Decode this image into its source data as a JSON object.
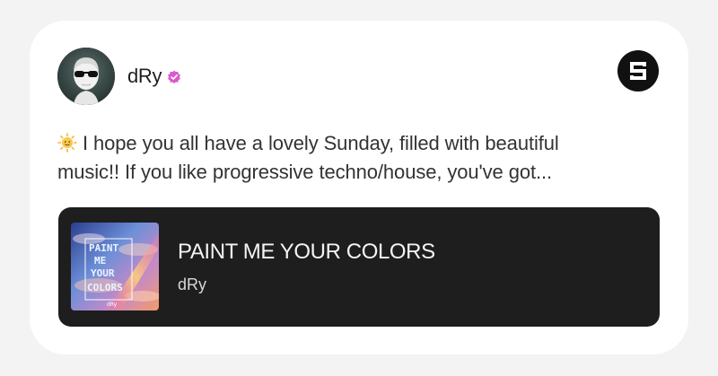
{
  "post": {
    "author": "dRy",
    "text_line1": "I hope you all have a lovely Sunday, filled with beautiful",
    "text_line2": "music!!  If you like progressive techno/house, you've got..."
  },
  "track": {
    "title": "PAINT ME YOUR COLORS",
    "artist": "dRy",
    "cover_text": [
      "PAINT",
      "ME",
      "YOUR",
      "COLORS"
    ],
    "cover_credit": "dRy"
  },
  "icons": {
    "verified": "verified-badge-icon",
    "platform": "sound-xyz-logo-icon",
    "emoji": "sun-emoji-icon"
  },
  "colors": {
    "page_bg": "#f3f3f3",
    "card_bg": "#ffffff",
    "track_bg": "#1e1e1e",
    "verified": "#d95ac8"
  }
}
